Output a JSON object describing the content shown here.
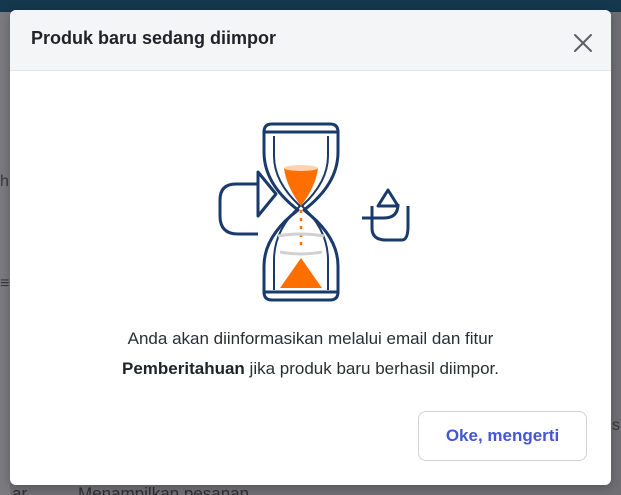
{
  "background": {
    "left_glyph_1": "h",
    "left_glyph_2": "≡",
    "right_glyph": "s",
    "bottom_left_text": "ar",
    "bottom_text": "Menampilkan pesanan"
  },
  "dialog": {
    "title": "Produk baru sedang diimpor",
    "close_icon": "close-icon",
    "illustration": "hourglass-refresh-icon",
    "message_line1": "Anda akan diinformasikan melalui email dan fitur",
    "message_bold": "Pemberitahuan",
    "message_line2_rest": " jika produk baru berhasil diimpor.",
    "ok_button_label": "Oke, mengerti"
  },
  "colors": {
    "accent_orange": "#ff6f00",
    "outline_navy": "#1a3a6b",
    "button_text_blue": "#4455d6",
    "header_bg": "#f4f5f7",
    "overlay": "#6e6e73"
  }
}
